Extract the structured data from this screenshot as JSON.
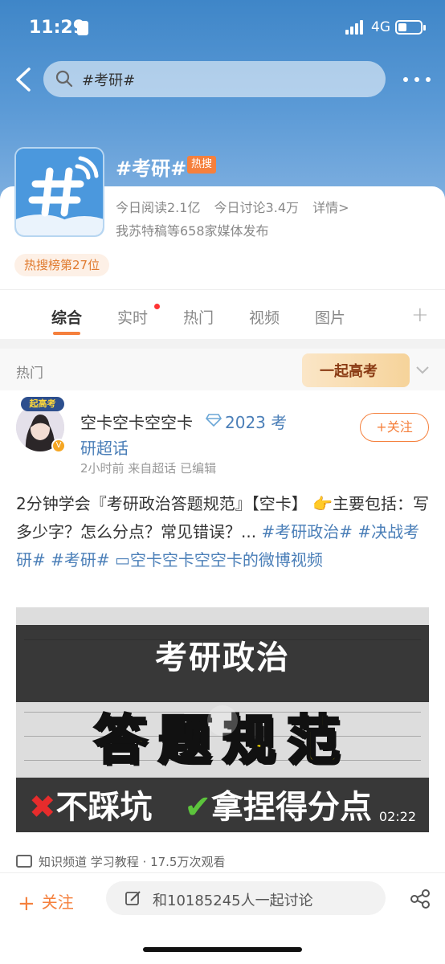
{
  "status": {
    "time": "11:29",
    "network": "4G"
  },
  "search": {
    "query": "#考研#"
  },
  "topic": {
    "title": "#考研#",
    "tag": "热搜",
    "reads": "今日阅读2.1亿",
    "discussions": "今日讨论3.4万",
    "detail_link": "详情>",
    "media": "我苏特稿等658家媒体发布",
    "rank": "热搜榜第27位"
  },
  "tabs": [
    {
      "label": "综合"
    },
    {
      "label": "实时"
    },
    {
      "label": "热门"
    },
    {
      "label": "视频"
    },
    {
      "label": "图片"
    }
  ],
  "section": {
    "label": "热门",
    "banner": "一起高考"
  },
  "post": {
    "avatar_badge": "起高考",
    "author": "空卡空卡空空卡",
    "super_topic_line1": "2023 考",
    "super_topic_line2": "研超话",
    "meta": "2小时前  来自超话  已编辑",
    "follow_label": "+关注",
    "text_plain": "2分钟学会『考研政治答题规范』【空卡】 👉主要包括：写多少字？怎么分点？常见错误？... ",
    "tag1": "#考研政治#",
    "tag2": "#决战考研#",
    "tag3": "#考研#",
    "video_link": "▭空卡空卡空空卡的微博视频"
  },
  "video": {
    "line1": "考研政治",
    "line2": "答题规范",
    "line3a": "不踩坑",
    "line3b": "拿捏得分点",
    "duration": "02:22",
    "footer": "知识频道 学习教程 · 17.5万次观看"
  },
  "bottom": {
    "follow_label": "关注",
    "discuss_label": "和10185245人一起讨论"
  },
  "colors": {
    "accent": "#f5803d",
    "link": "#4b7fb8",
    "hero": "#3f86c8"
  }
}
